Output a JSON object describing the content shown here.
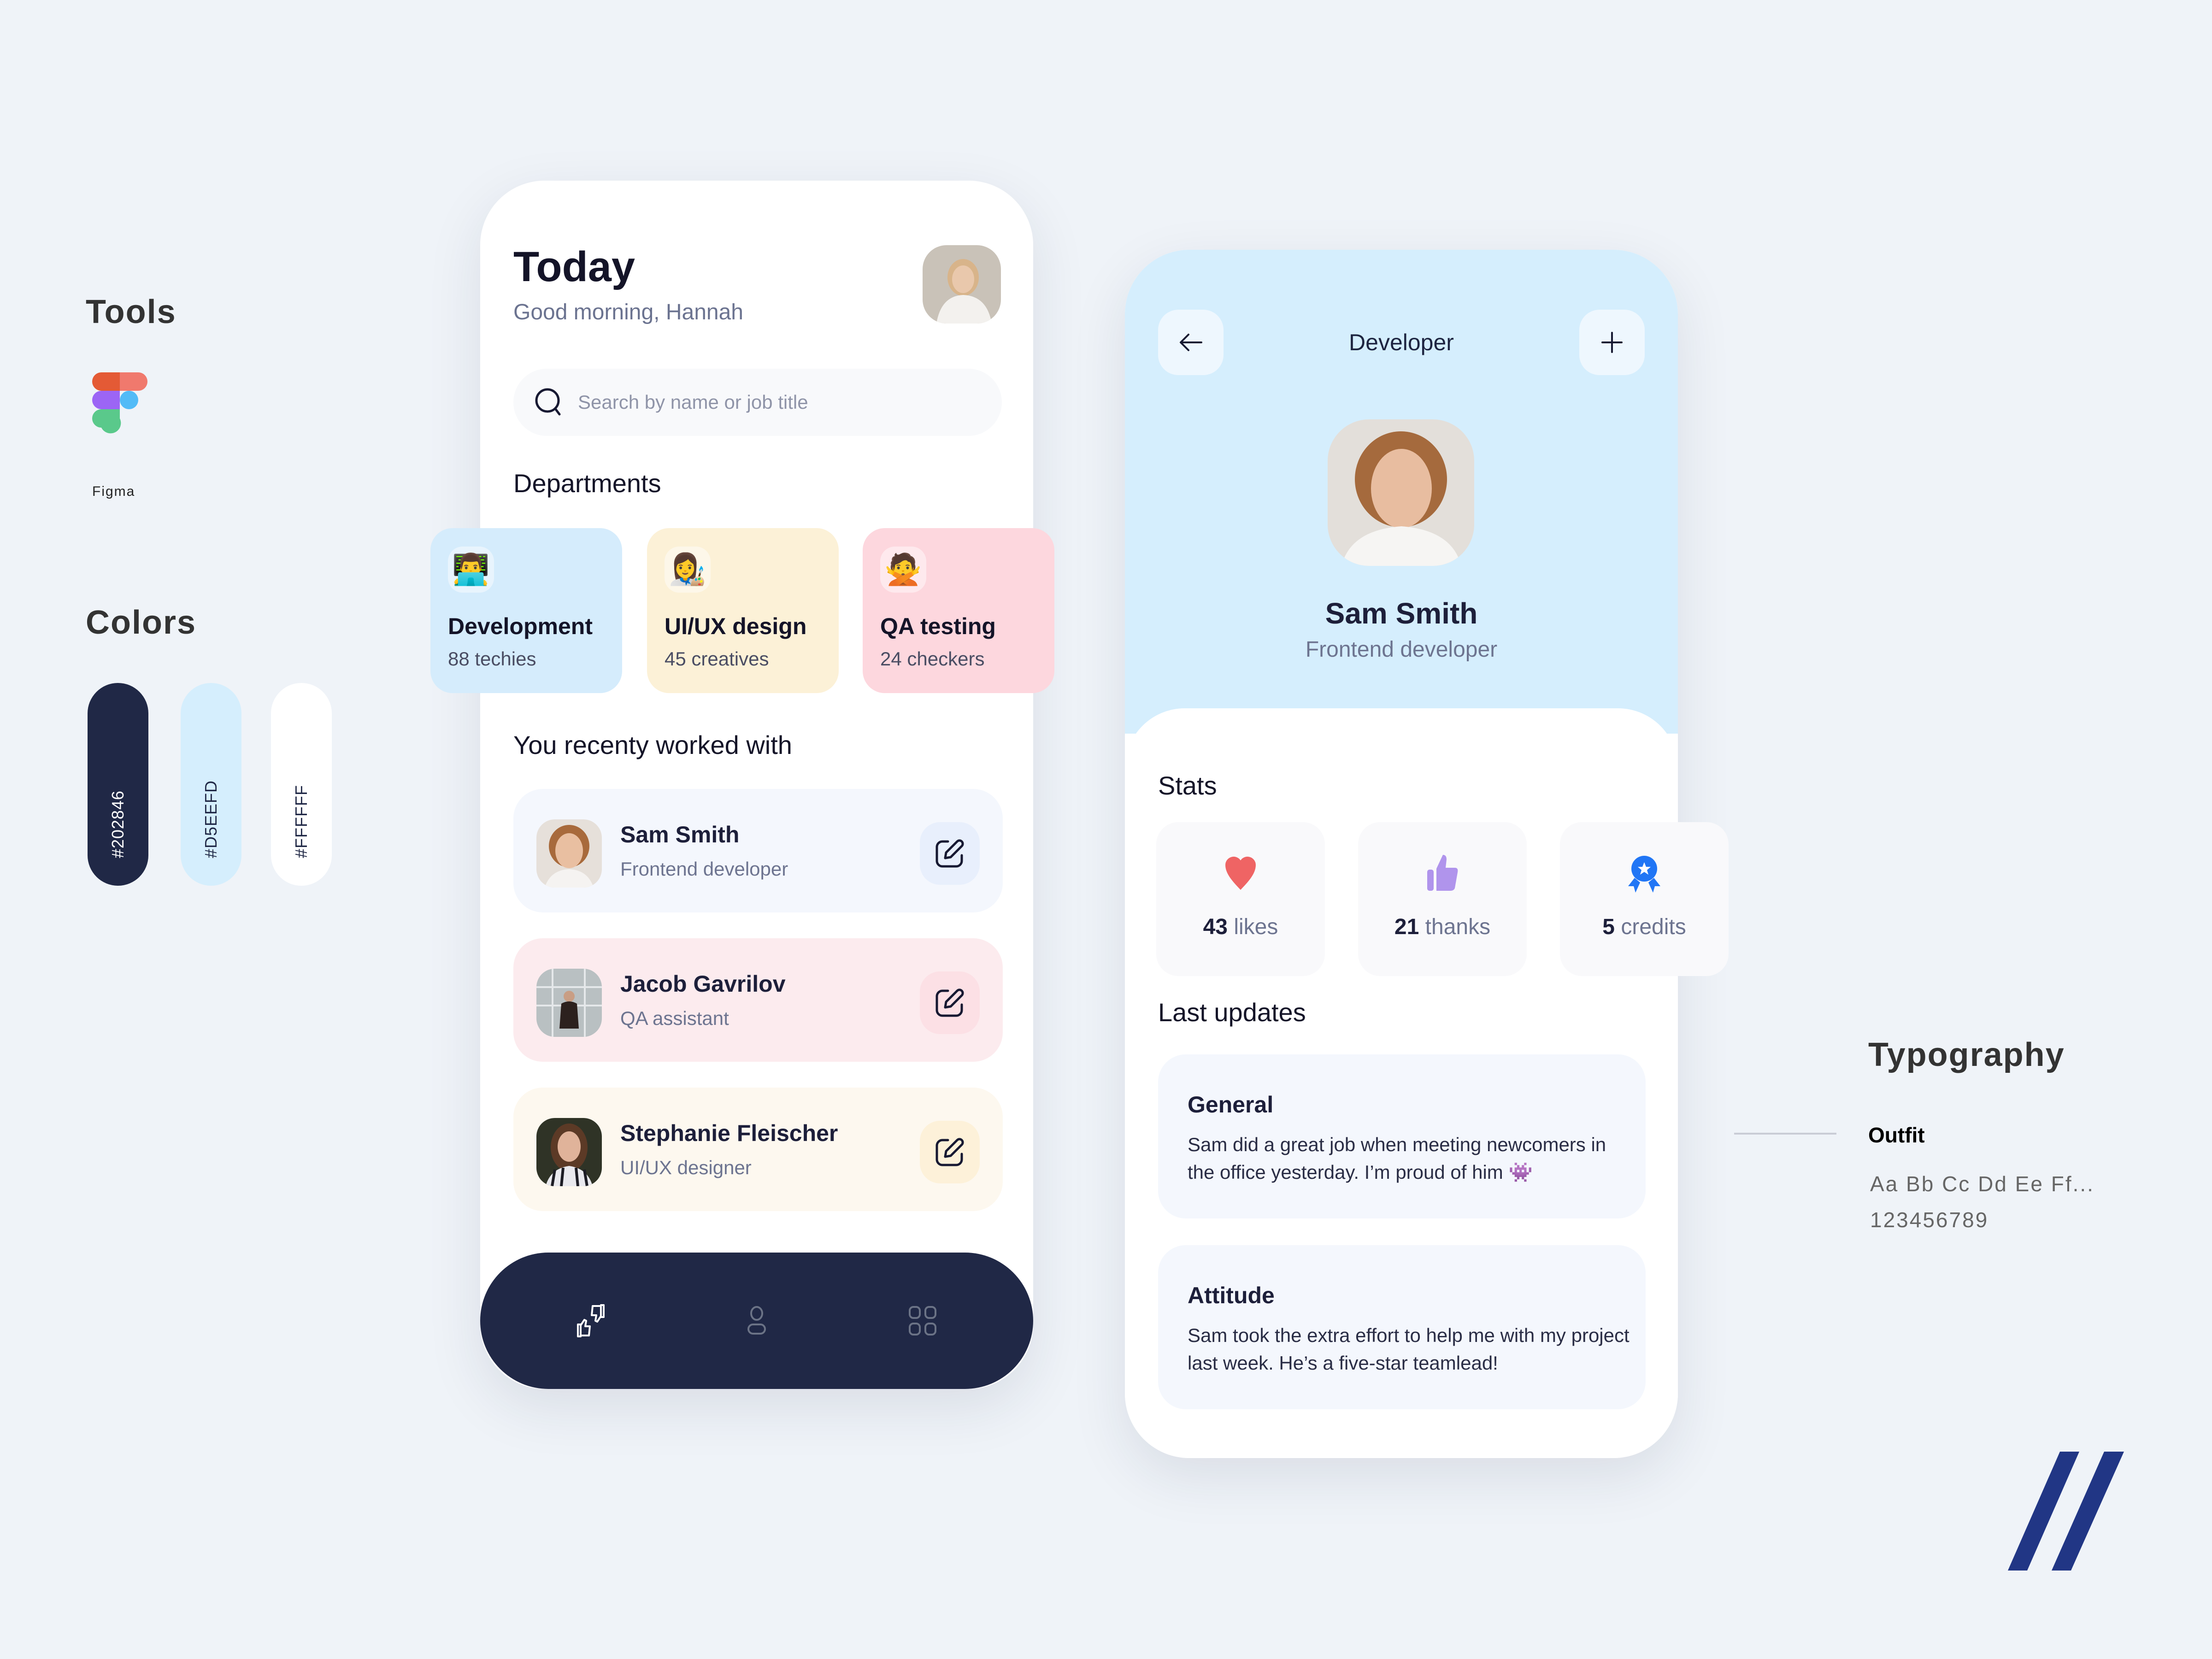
{
  "tools": {
    "title": "Tools",
    "items": [
      {
        "name": "Figma",
        "icon": "figma-logo-icon"
      }
    ]
  },
  "colors": {
    "title": "Colors",
    "swatches": [
      {
        "hex": "#202846",
        "label": "#202846",
        "text_color": "#ffffff"
      },
      {
        "hex": "#D5EEFD",
        "label": "#D5EEFD",
        "text_color": "#202846"
      },
      {
        "hex": "#FFFFFF",
        "label": "#FFFFFF",
        "text_color": "#202846"
      }
    ]
  },
  "home_screen": {
    "title": "Today",
    "greeting": "Good morning, Hannah",
    "search": {
      "placeholder": "Search by name or job title",
      "value": ""
    },
    "departments_title": "Departments",
    "departments": [
      {
        "name": "Development",
        "count": "88 techies",
        "emoji": "👨‍💻",
        "color": "#d5ecfc"
      },
      {
        "name": "UI/UX design",
        "count": "45 creatives",
        "emoji": "👩‍🎨",
        "color": "#fcf1d7"
      },
      {
        "name": "QA testing",
        "count": "24 checkers",
        "emoji": "🙅",
        "color": "#fdd7de"
      }
    ],
    "recent_title": "You recenty worked with",
    "recent": [
      {
        "name": "Sam Smith",
        "role": "Frontend developer",
        "bg": "#f4f7fd",
        "btn_bg": "#e8effc"
      },
      {
        "name": "Jacob Gavrilov",
        "role": "QA assistant",
        "bg": "#fcebee",
        "btn_bg": "#fce0e5"
      },
      {
        "name": "Stephanie Fleischer",
        "role": "UI/UX designer",
        "bg": "#fdf8ef",
        "btn_bg": "#fdf1d9"
      }
    ],
    "nav": [
      {
        "name": "kudos",
        "icon": "thumbs-exchange-icon",
        "active": true
      },
      {
        "name": "profile",
        "icon": "user-icon",
        "active": false
      },
      {
        "name": "apps",
        "icon": "grid-icon",
        "active": false
      }
    ]
  },
  "profile_screen": {
    "header_title": "Developer",
    "back_icon": "arrow-left-icon",
    "add_icon": "plus-icon",
    "name": "Sam Smith",
    "role": "Frontend developer",
    "stats_title": "Stats",
    "stats": [
      {
        "value": "43",
        "unit": "likes",
        "icon": "heart-icon",
        "color": "#ef6464"
      },
      {
        "value": "21",
        "unit": "thanks",
        "icon": "thumbs-up-icon",
        "color": "#b094ec"
      },
      {
        "value": "5",
        "unit": "credits",
        "icon": "award-badge-icon",
        "color": "#2176f5"
      }
    ],
    "updates_title": "Last updates",
    "updates": [
      {
        "title": "General",
        "body": "Sam did a great job when meeting newcomers in the office yesterday. I’m proud of him 👾"
      },
      {
        "title": "Attitude",
        "body": "Sam took the extra effort to help me with my project last week. He’s a five-star teamlead!"
      }
    ]
  },
  "typography": {
    "title": "Typography",
    "font_name": "Outfit",
    "sample_letters": "Aa Bb Cc Dd Ee Ff...",
    "sample_numbers": "123456789"
  },
  "brand": {
    "logo": "double-slash-logo-icon",
    "color": "#213685"
  }
}
